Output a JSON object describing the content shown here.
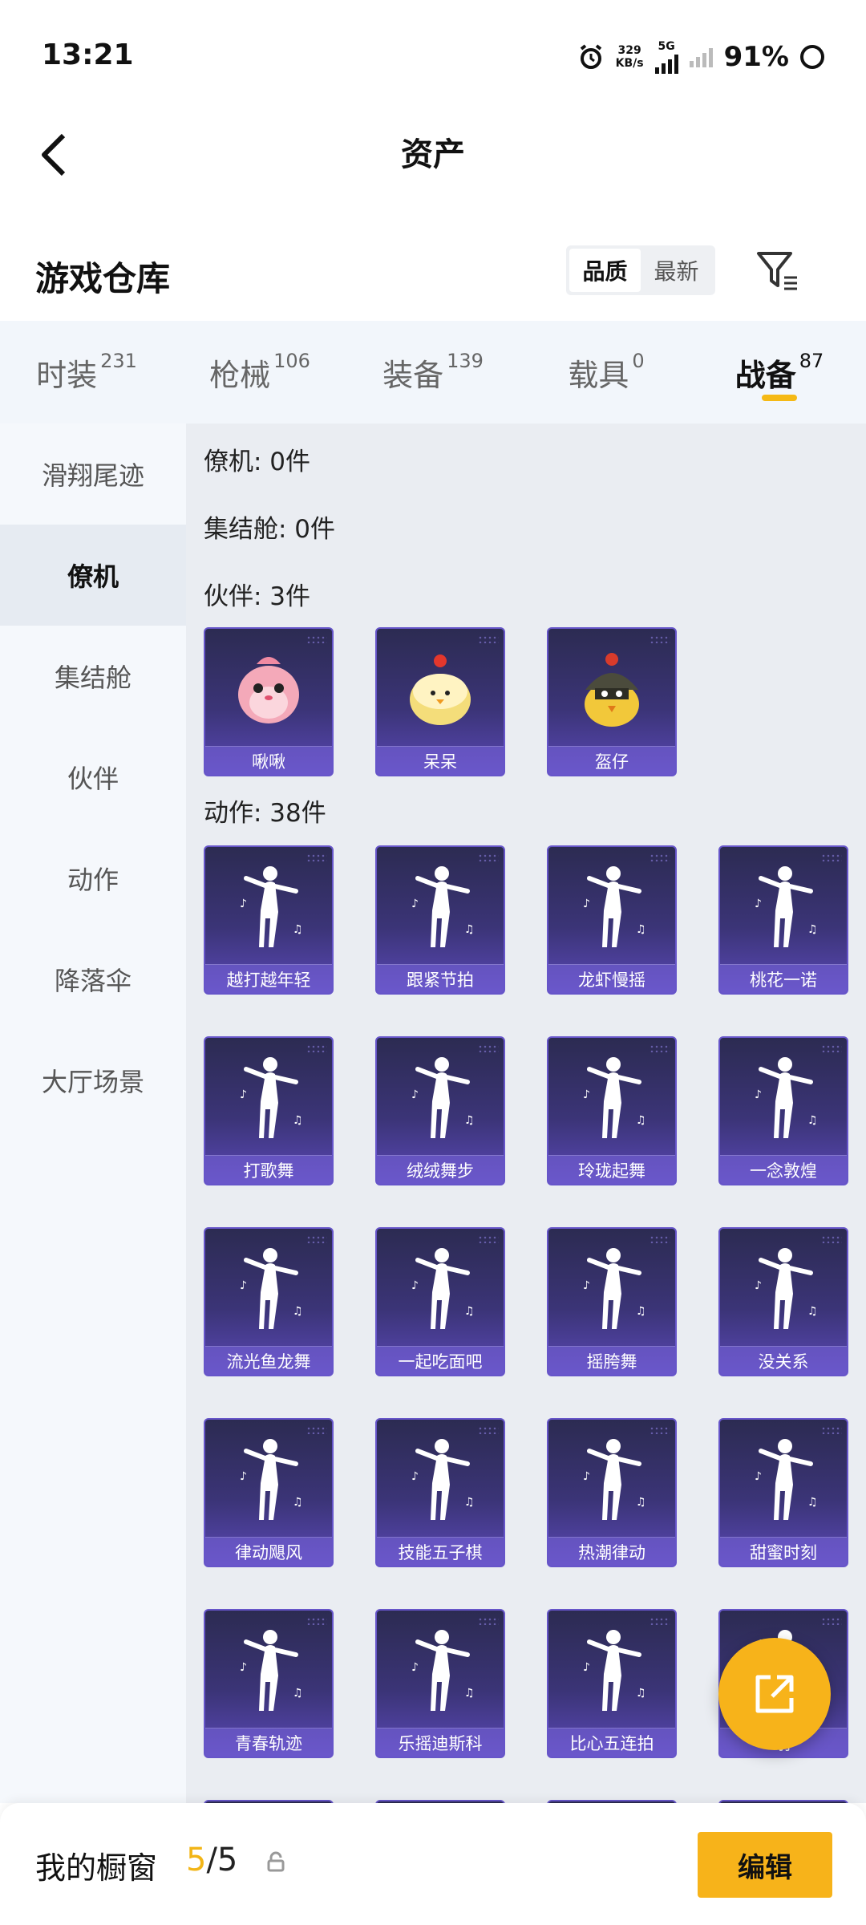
{
  "status_bar": {
    "time": "13:21",
    "net_speed_value": "329",
    "net_speed_unit": "KB/s",
    "network": "5G",
    "battery": "91%"
  },
  "header": {
    "title": "资产"
  },
  "warehouse": {
    "title": "游戏仓库",
    "sort_options": [
      "品质",
      "最新"
    ],
    "sort_selected": "品质"
  },
  "tabs": [
    {
      "label": "时装",
      "count": "231"
    },
    {
      "label": "枪械",
      "count": "106"
    },
    {
      "label": "装备",
      "count": "139"
    },
    {
      "label": "载具",
      "count": "0"
    },
    {
      "label": "战备",
      "count": "87",
      "active": true
    }
  ],
  "sidebar": {
    "items": [
      "滑翔尾迹",
      "僚机",
      "集结舱",
      "伙伴",
      "动作",
      "降落伞",
      "大厅场景"
    ],
    "active": "僚机"
  },
  "sections": {
    "wingman": "僚机: 0件",
    "rally": "集结舱: 0件",
    "partner": "伙伴: 3件",
    "action": "动作: 38件"
  },
  "partners": [
    "啾啾",
    "呆呆",
    "盔仔"
  ],
  "actions": [
    "越打越年轻",
    "跟紧节拍",
    "龙虾慢摇",
    "桃花一诺",
    "打歌舞",
    "绒绒舞步",
    "玲珑起舞",
    "一念敦煌",
    "流光鱼龙舞",
    "一起吃面吧",
    "摇胯舞",
    "没关系",
    "律动飓风",
    "技能五子棋",
    "热潮律动",
    "甜蜜时刻",
    "青春轨迹",
    "乐摇迪斯科",
    "比心五连拍",
    "射"
  ],
  "bottom_bar": {
    "title": "我的橱窗",
    "count_current": "5",
    "count_total": "/5",
    "edit_label": "编辑"
  },
  "colors": {
    "accent": "#f7b31a",
    "card_bg": "#3b3477"
  }
}
